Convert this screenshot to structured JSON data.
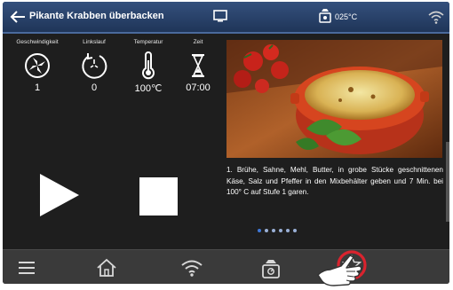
{
  "header": {
    "title": "Pikante Krabben überbacken",
    "scale_reading": "025°C",
    "icons": {
      "back": "back-arrow-icon",
      "display": "monitor-icon",
      "scale": "kitchen-scale-icon",
      "wifi": "wifi-icon"
    }
  },
  "params": [
    {
      "label": "Geschwindigkeit",
      "value": "1",
      "icon": "speed-icon"
    },
    {
      "label": "Linkslauf",
      "value": "0",
      "icon": "reverse-rotation-icon"
    },
    {
      "label": "Temperatur",
      "value": "100℃",
      "icon": "thermometer-icon"
    },
    {
      "label": "Zeit",
      "value": "07:00",
      "icon": "hourglass-icon"
    }
  ],
  "controls": {
    "play_icon": "play-icon",
    "stop_icon": "stop-icon"
  },
  "recipe": {
    "step_text": "1. Brühe, Sahne, Mehl, Butter, in grobe Stücke geschnittenen Käse, Salz und Pfeffer in den Mixbehälter geben und 7 Min. bei 100° C auf Stufe 1 garen.",
    "page_count": 6,
    "active_page": 1
  },
  "bottom_nav": [
    {
      "name": "menu",
      "icon": "menu-icon"
    },
    {
      "name": "home",
      "icon": "home-icon"
    },
    {
      "name": "wifi",
      "icon": "wifi-icon"
    },
    {
      "name": "scale",
      "icon": "kitchen-scale-icon"
    },
    {
      "name": "favorite",
      "icon": "star-icon",
      "highlighted": true
    }
  ],
  "colors": {
    "highlight_ring": "#d9232e",
    "accent": "#3f78d8"
  }
}
